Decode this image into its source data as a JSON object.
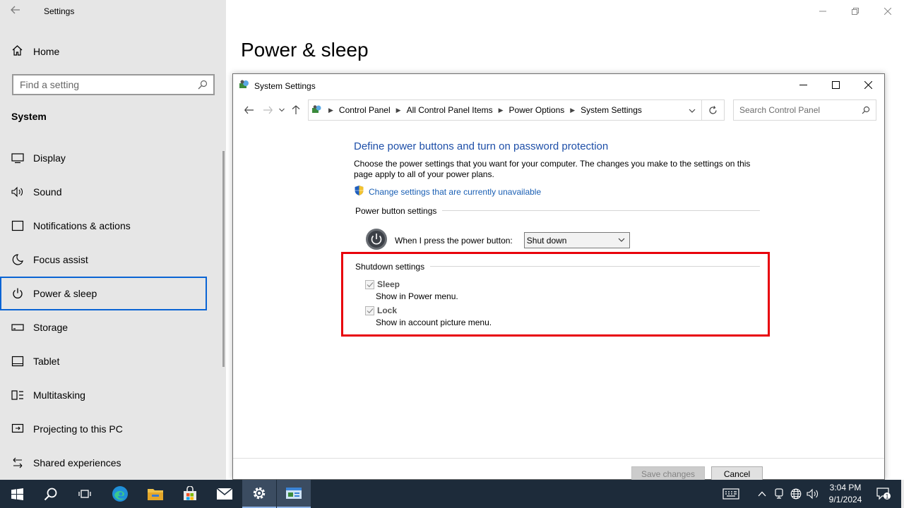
{
  "settings": {
    "app_title": "Settings",
    "home_label": "Home",
    "search_placeholder": "Find a setting",
    "section_label": "System",
    "page_title": "Power & sleep",
    "nav": [
      {
        "label": "Display",
        "icon": "display-icon"
      },
      {
        "label": "Sound",
        "icon": "sound-icon"
      },
      {
        "label": "Notifications & actions",
        "icon": "notifications-icon"
      },
      {
        "label": "Focus assist",
        "icon": "moon-icon"
      },
      {
        "label": "Power & sleep",
        "icon": "power-icon",
        "active": true
      },
      {
        "label": "Storage",
        "icon": "storage-icon"
      },
      {
        "label": "Tablet",
        "icon": "tablet-icon"
      },
      {
        "label": "Multitasking",
        "icon": "multitasking-icon"
      },
      {
        "label": "Projecting to this PC",
        "icon": "projecting-icon"
      },
      {
        "label": "Shared experiences",
        "icon": "shared-icon"
      }
    ]
  },
  "dialog": {
    "title": "System Settings",
    "breadcrumb": [
      "Control Panel",
      "All Control Panel Items",
      "Power Options",
      "System Settings"
    ],
    "search_placeholder": "Search Control Panel",
    "heading": "Define power buttons and turn on password protection",
    "description": "Choose the power settings that you want for your computer. The changes you make to the settings on this page apply to all of your power plans.",
    "change_link": "Change settings that are currently unavailable",
    "power_group_title": "Power button settings",
    "power_button_label": "When I press the power button:",
    "power_button_value": "Shut down",
    "shutdown_group_title": "Shutdown settings",
    "options": [
      {
        "label": "Sleep",
        "sub": "Show in Power menu.",
        "checked": true
      },
      {
        "label": "Lock",
        "sub": "Show in account picture menu.",
        "checked": true
      }
    ],
    "save_label": "Save changes",
    "cancel_label": "Cancel"
  },
  "taskbar": {
    "time": "3:04 PM",
    "date": "9/1/2024",
    "notification_count": "1"
  },
  "colors": {
    "sidebar_bg": "#e6e6e6",
    "active_border": "#0a64d4",
    "highlight": "#e8000b",
    "heading_blue": "#1e4fa8",
    "taskbar_bg": "#1d2b3a"
  }
}
